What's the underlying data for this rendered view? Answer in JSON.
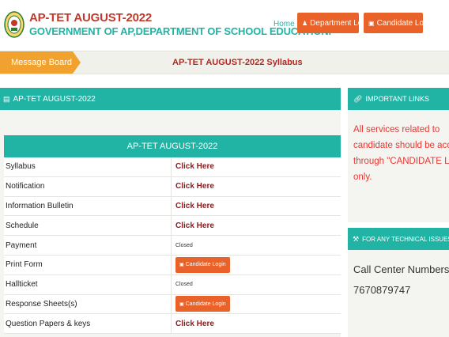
{
  "header": {
    "title": "AP-TET AUGUST-2022",
    "subtitle": "GOVERNMENT OF AP,DEPARTMENT OF SCHOOL EDUCATION.",
    "nav": {
      "home": "Home",
      "department_login": "Department Login",
      "candidate_login": "Candidate Login"
    }
  },
  "message_board": {
    "label": "Message Board",
    "text": "AP-TET AUGUST-2022 Syllabus"
  },
  "main": {
    "section_title": "AP-TET AUGUST-2022",
    "table_title": "AP-TET AUGUST-2022",
    "rows": [
      {
        "label": "Syllabus",
        "action": "Click Here"
      },
      {
        "label": "Notification",
        "action": "Click Here"
      },
      {
        "label": "Information Bulletin",
        "action": "Click Here"
      },
      {
        "label": "Schedule",
        "action": "Click Here"
      },
      {
        "label": "Payment",
        "action": "Closed"
      },
      {
        "label": "Print Form",
        "action": "Candidate Login"
      },
      {
        "label": "Hallticket",
        "action": "Closed"
      },
      {
        "label": "Response Sheets(s)",
        "action": "Candidate Login"
      },
      {
        "label": "Question Papers & keys",
        "action": "Click Here"
      }
    ]
  },
  "important_links": {
    "title": "IMPORTANT LINKS",
    "lines": [
      "All services related to",
      "candidate should be access",
      "through \"CANDIDATE LOGIN\"",
      "only."
    ]
  },
  "technical": {
    "title": "FOR ANY TECHNICAL ISSUES",
    "call_center_label": "Call Center Numbers:",
    "call_center_number": "7670879747"
  },
  "colors": {
    "teal": "#21b3a3",
    "orange_button": "#e8622a",
    "message_tab": "#f0a12e",
    "title_red": "#c0392b",
    "notice_red": "#e53935",
    "link_maroon": "#8b1a1a"
  },
  "icons": {
    "logo": "ap-government-emblem",
    "user": "user-icon",
    "dept": "user-tie-icon",
    "section": "list-icon",
    "links": "link-icon",
    "issues": "wrench-icon"
  }
}
